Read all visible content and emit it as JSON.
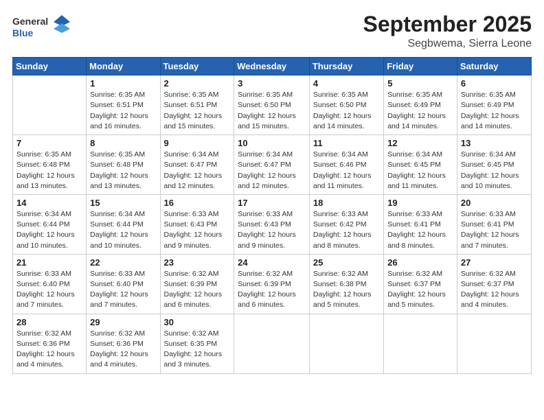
{
  "header": {
    "logo_general": "General",
    "logo_blue": "Blue",
    "month_title": "September 2025",
    "location": "Segbwema, Sierra Leone"
  },
  "days_of_week": [
    "Sunday",
    "Monday",
    "Tuesday",
    "Wednesday",
    "Thursday",
    "Friday",
    "Saturday"
  ],
  "weeks": [
    [
      {
        "day": "",
        "info": ""
      },
      {
        "day": "1",
        "info": "Sunrise: 6:35 AM\nSunset: 6:51 PM\nDaylight: 12 hours\nand 16 minutes."
      },
      {
        "day": "2",
        "info": "Sunrise: 6:35 AM\nSunset: 6:51 PM\nDaylight: 12 hours\nand 15 minutes."
      },
      {
        "day": "3",
        "info": "Sunrise: 6:35 AM\nSunset: 6:50 PM\nDaylight: 12 hours\nand 15 minutes."
      },
      {
        "day": "4",
        "info": "Sunrise: 6:35 AM\nSunset: 6:50 PM\nDaylight: 12 hours\nand 14 minutes."
      },
      {
        "day": "5",
        "info": "Sunrise: 6:35 AM\nSunset: 6:49 PM\nDaylight: 12 hours\nand 14 minutes."
      },
      {
        "day": "6",
        "info": "Sunrise: 6:35 AM\nSunset: 6:49 PM\nDaylight: 12 hours\nand 14 minutes."
      }
    ],
    [
      {
        "day": "7",
        "info": "Sunrise: 6:35 AM\nSunset: 6:48 PM\nDaylight: 12 hours\nand 13 minutes."
      },
      {
        "day": "8",
        "info": "Sunrise: 6:35 AM\nSunset: 6:48 PM\nDaylight: 12 hours\nand 13 minutes."
      },
      {
        "day": "9",
        "info": "Sunrise: 6:34 AM\nSunset: 6:47 PM\nDaylight: 12 hours\nand 12 minutes."
      },
      {
        "day": "10",
        "info": "Sunrise: 6:34 AM\nSunset: 6:47 PM\nDaylight: 12 hours\nand 12 minutes."
      },
      {
        "day": "11",
        "info": "Sunrise: 6:34 AM\nSunset: 6:46 PM\nDaylight: 12 hours\nand 11 minutes."
      },
      {
        "day": "12",
        "info": "Sunrise: 6:34 AM\nSunset: 6:45 PM\nDaylight: 12 hours\nand 11 minutes."
      },
      {
        "day": "13",
        "info": "Sunrise: 6:34 AM\nSunset: 6:45 PM\nDaylight: 12 hours\nand 10 minutes."
      }
    ],
    [
      {
        "day": "14",
        "info": "Sunrise: 6:34 AM\nSunset: 6:44 PM\nDaylight: 12 hours\nand 10 minutes."
      },
      {
        "day": "15",
        "info": "Sunrise: 6:34 AM\nSunset: 6:44 PM\nDaylight: 12 hours\nand 10 minutes."
      },
      {
        "day": "16",
        "info": "Sunrise: 6:33 AM\nSunset: 6:43 PM\nDaylight: 12 hours\nand 9 minutes."
      },
      {
        "day": "17",
        "info": "Sunrise: 6:33 AM\nSunset: 6:43 PM\nDaylight: 12 hours\nand 9 minutes."
      },
      {
        "day": "18",
        "info": "Sunrise: 6:33 AM\nSunset: 6:42 PM\nDaylight: 12 hours\nand 8 minutes."
      },
      {
        "day": "19",
        "info": "Sunrise: 6:33 AM\nSunset: 6:41 PM\nDaylight: 12 hours\nand 8 minutes."
      },
      {
        "day": "20",
        "info": "Sunrise: 6:33 AM\nSunset: 6:41 PM\nDaylight: 12 hours\nand 7 minutes."
      }
    ],
    [
      {
        "day": "21",
        "info": "Sunrise: 6:33 AM\nSunset: 6:40 PM\nDaylight: 12 hours\nand 7 minutes."
      },
      {
        "day": "22",
        "info": "Sunrise: 6:33 AM\nSunset: 6:40 PM\nDaylight: 12 hours\nand 7 minutes."
      },
      {
        "day": "23",
        "info": "Sunrise: 6:32 AM\nSunset: 6:39 PM\nDaylight: 12 hours\nand 6 minutes."
      },
      {
        "day": "24",
        "info": "Sunrise: 6:32 AM\nSunset: 6:39 PM\nDaylight: 12 hours\nand 6 minutes."
      },
      {
        "day": "25",
        "info": "Sunrise: 6:32 AM\nSunset: 6:38 PM\nDaylight: 12 hours\nand 5 minutes."
      },
      {
        "day": "26",
        "info": "Sunrise: 6:32 AM\nSunset: 6:37 PM\nDaylight: 12 hours\nand 5 minutes."
      },
      {
        "day": "27",
        "info": "Sunrise: 6:32 AM\nSunset: 6:37 PM\nDaylight: 12 hours\nand 4 minutes."
      }
    ],
    [
      {
        "day": "28",
        "info": "Sunrise: 6:32 AM\nSunset: 6:36 PM\nDaylight: 12 hours\nand 4 minutes."
      },
      {
        "day": "29",
        "info": "Sunrise: 6:32 AM\nSunset: 6:36 PM\nDaylight: 12 hours\nand 4 minutes."
      },
      {
        "day": "30",
        "info": "Sunrise: 6:32 AM\nSunset: 6:35 PM\nDaylight: 12 hours\nand 3 minutes."
      },
      {
        "day": "",
        "info": ""
      },
      {
        "day": "",
        "info": ""
      },
      {
        "day": "",
        "info": ""
      },
      {
        "day": "",
        "info": ""
      }
    ]
  ]
}
